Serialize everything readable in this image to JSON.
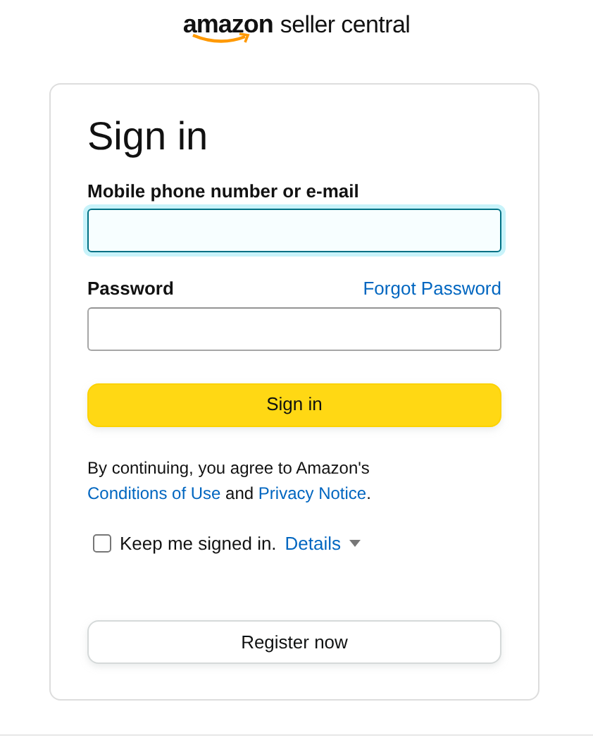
{
  "logo": {
    "brand": "amazon",
    "product": "seller central"
  },
  "title": "Sign in",
  "email": {
    "label": "Mobile phone number or e-mail",
    "focused": true
  },
  "password": {
    "label": "Password",
    "forgot_link": "Forgot Password",
    "focused": false
  },
  "sign_in_button": "Sign in",
  "notice": [
    {
      "kind": "text",
      "text": "By continuing, you agree to Amazon's "
    },
    {
      "kind": "link",
      "text": "Conditions of Use"
    },
    {
      "kind": "text",
      "text": " and "
    },
    {
      "kind": "link",
      "text": "Privacy Notice"
    },
    {
      "kind": "text",
      "text": "."
    }
  ],
  "keep_signed_in": {
    "label": "Keep me signed in.",
    "checked": false,
    "details_link": "Details"
  },
  "register_button": "Register now"
}
